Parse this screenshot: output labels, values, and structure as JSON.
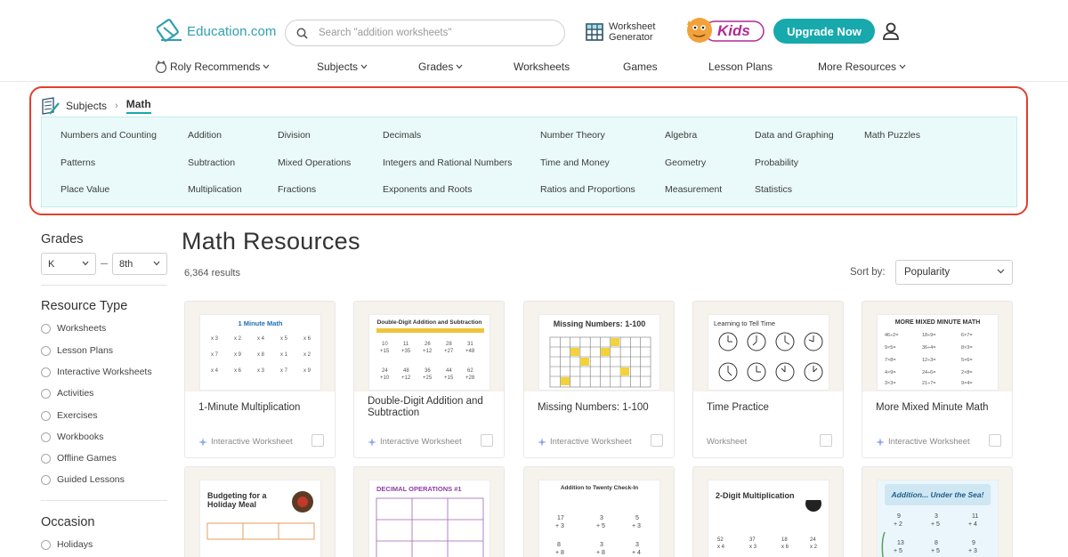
{
  "header": {
    "logo_text": "Education.com",
    "search_placeholder": "Search \"addition worksheets\"",
    "worksheet_generator": [
      "Worksheet",
      "Generator"
    ],
    "kids_label": "Kids",
    "upgrade_label": "Upgrade Now"
  },
  "nav": [
    {
      "label": "Roly Recommends",
      "dropdown": true
    },
    {
      "label": "Subjects",
      "dropdown": true
    },
    {
      "label": "Grades",
      "dropdown": true
    },
    {
      "label": "Worksheets",
      "dropdown": false
    },
    {
      "label": "Games",
      "dropdown": false
    },
    {
      "label": "Lesson Plans",
      "dropdown": false
    },
    {
      "label": "More Resources",
      "dropdown": true
    }
  ],
  "breadcrumb": {
    "parent": "Subjects",
    "current": "Math"
  },
  "topics": [
    [
      "Numbers and Counting",
      "Patterns",
      "Place Value"
    ],
    [
      "Addition",
      "Subtraction",
      "Multiplication"
    ],
    [
      "Division",
      "Mixed Operations",
      "Fractions"
    ],
    [
      "Decimals",
      "Integers and Rational Numbers",
      "Exponents and Roots"
    ],
    [
      "Number Theory",
      "Time and Money",
      "Ratios and Proportions"
    ],
    [
      "Algebra",
      "Geometry",
      "Measurement"
    ],
    [
      "Data and Graphing",
      "Probability",
      "Statistics"
    ],
    [
      "Math Puzzles"
    ]
  ],
  "sidebar": {
    "grades_heading": "Grades",
    "grade_from": "K",
    "grade_to": "8th",
    "resource_heading": "Resource Type",
    "resource_types": [
      "Worksheets",
      "Lesson Plans",
      "Interactive Worksheets",
      "Activities",
      "Exercises",
      "Workbooks",
      "Offline Games",
      "Guided Lessons"
    ],
    "occasion_heading": "Occasion",
    "occasions": [
      "Holidays"
    ]
  },
  "main": {
    "title": "Math Resources",
    "results": "6,364 results",
    "sort_label": "Sort by:",
    "sort_value": "Popularity"
  },
  "cards": [
    {
      "title": "1-Minute Multiplication",
      "type": "Interactive Worksheet",
      "interactive": true,
      "thumb": "1 Minute Math"
    },
    {
      "title": "Double-Digit Addition and Subtraction",
      "type": "Interactive Worksheet",
      "interactive": true,
      "thumb": "Double-Digit Addition and Subtraction"
    },
    {
      "title": "Missing Numbers: 1-100",
      "type": "Interactive Worksheet",
      "interactive": true,
      "thumb": "Missing Numbers: 1-100"
    },
    {
      "title": "Time Practice",
      "type": "Worksheet",
      "interactive": false,
      "thumb": "Learning to Tell Time"
    },
    {
      "title": "More Mixed Minute Math",
      "type": "Interactive Worksheet",
      "interactive": true,
      "thumb": "MORE MIXED MINUTE MATH"
    }
  ],
  "cards_row2": [
    {
      "thumb": "Budgeting for a Holiday Meal"
    },
    {
      "thumb": "DECIMAL OPERATIONS #1"
    },
    {
      "thumb": "Addition to Twenty Check-In"
    },
    {
      "thumb": "2-Digit Multiplication"
    },
    {
      "thumb": "Addition... Under the Sea!"
    }
  ]
}
